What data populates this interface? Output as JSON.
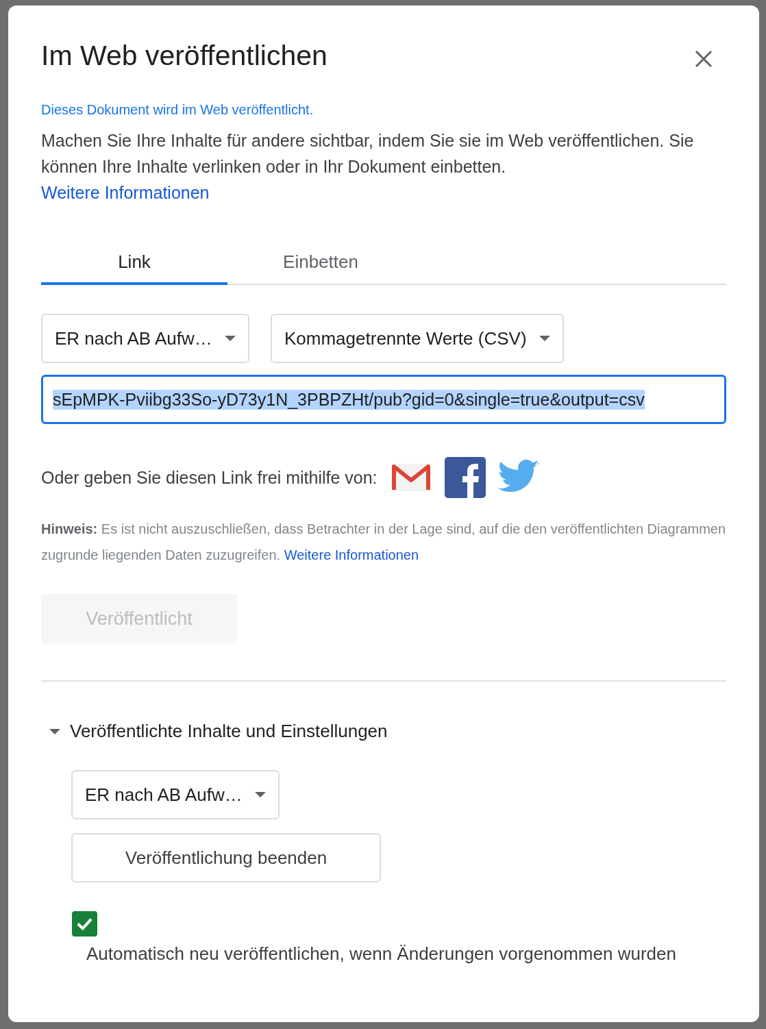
{
  "dialog": {
    "title": "Im Web veröffentlichen",
    "status": "Dieses Dokument wird im Web veröffentlicht.",
    "description": "Machen Sie Ihre Inhalte für andere sichtbar, indem Sie sie im Web veröffentlichen. Sie können Ihre Inhalte verlinken oder in Ihr Dokument einbetten.",
    "learn_more": "Weitere Informationen"
  },
  "tabs": [
    {
      "label": "Link",
      "selected": true
    },
    {
      "label": "Einbetten",
      "selected": false
    }
  ],
  "link": {
    "dropdowns": [
      "ER nach AB Aufw…",
      "Kommagetrennte Werte (CSV)"
    ],
    "url": "sEpMPK-Pviibg33So-yD73y1N_3PBPZHt/pub?gid=0&single=true&output=csv",
    "url_selected": true
  },
  "share": {
    "label": "Oder geben Sie diesen Link frei mithilfe von:"
  },
  "note": {
    "text": "**Hinweis:** Es ist nicht auszuschließen, dass Betrachter in der Lage sind, auf die den veröffentlichten Diagrammen zugrunde liegenden Daten zuzugreifen.",
    "link": "Weitere Informationen"
  },
  "publish_button": {
    "label": "Veröffentlicht",
    "disabled": true
  },
  "settings": {
    "title": "Veröffentlichte Inhalte und Einstellungen",
    "expanded": true,
    "dropdown": "ER nach AB Aufw…",
    "stop_button": "Veröffentlichung beenden",
    "auto_republish": {
      "label": "Automatisch neu veröffentlichen, wenn Änderungen vorgenommen wurden",
      "checked": true
    }
  }
}
